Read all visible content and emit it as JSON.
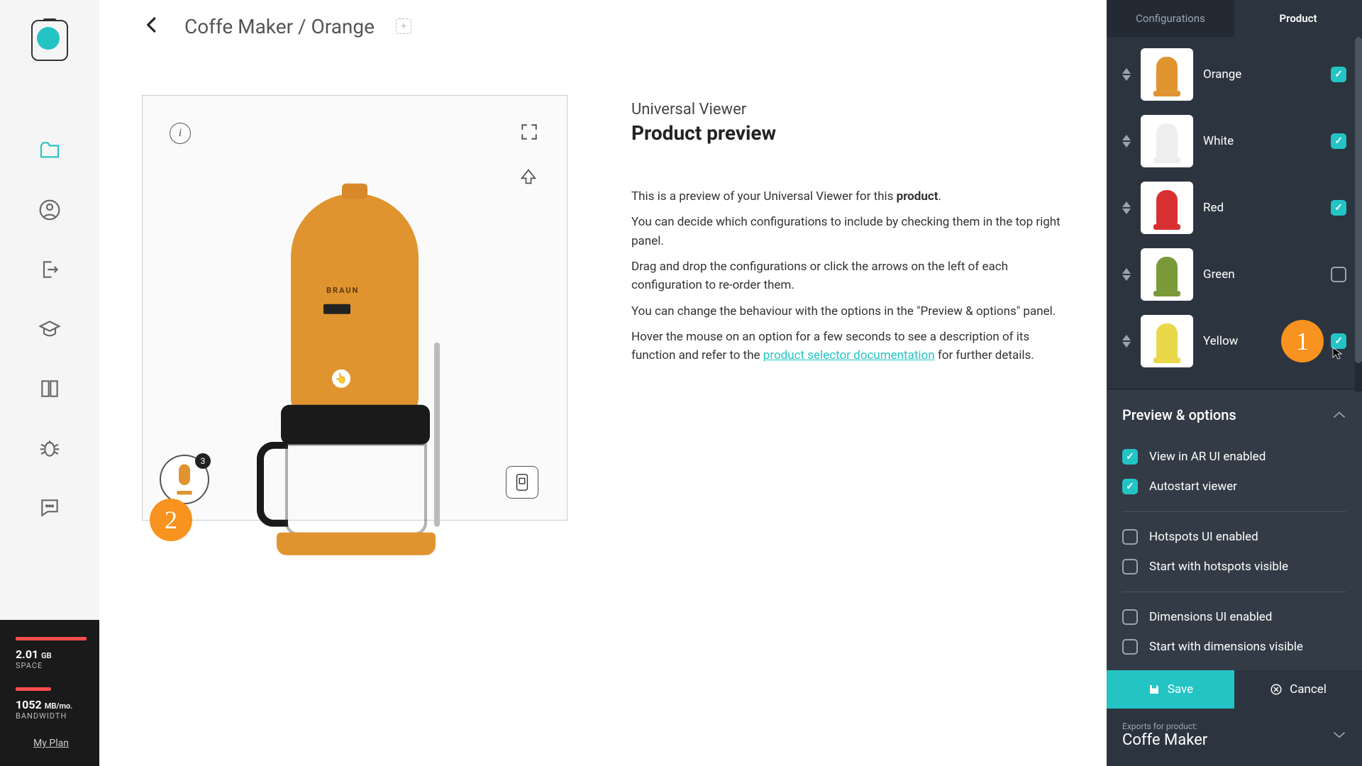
{
  "breadcrumb": "Coffe Maker / Orange",
  "sidebar_usage": {
    "space_value": "2.01",
    "space_unit": "GB",
    "space_label": "SPACE",
    "bandwidth_value": "1052",
    "bandwidth_unit": "MB/mo.",
    "bandwidth_label": "BANDWIDTH",
    "plan_link": "My Plan"
  },
  "viewer": {
    "info_icon": "i",
    "touch_icon": "👆",
    "brand_text": "BRAUN",
    "hotspot_badge": "3"
  },
  "info": {
    "subtitle": "Universal Viewer",
    "title": "Product preview",
    "p1_a": "This is a preview of your Universal Viewer for this ",
    "p1_b": "product",
    "p1_c": ".",
    "p2": "You can decide which configurations to include by checking them in the top right panel.",
    "p3": "Drag and drop the configurations or click the arrows on the left of each configuration to re-order them.",
    "p4": "You can change the behaviour with the options in the \"Preview & options\" panel.",
    "p5_a": "Hover the mouse on an option for a few seconds to see a description of its function and refer to the ",
    "p5_link": "product selector documentation",
    "p5_b": " for further details."
  },
  "panel": {
    "tabs": {
      "configurations": "Configurations",
      "product": "Product"
    },
    "configs": [
      {
        "name": "Orange",
        "color": "#e0942f",
        "checked": true
      },
      {
        "name": "White",
        "color": "#eeeeee",
        "checked": true
      },
      {
        "name": "Red",
        "color": "#d83030",
        "checked": true
      },
      {
        "name": "Green",
        "color": "#7a9a3a",
        "checked": false
      },
      {
        "name": "Yellow",
        "color": "#e8d84a",
        "checked": true
      }
    ],
    "options_title": "Preview & options",
    "options": [
      {
        "label": "View in AR UI enabled",
        "checked": true
      },
      {
        "label": "Autostart viewer",
        "checked": true
      },
      {
        "label": "Hotspots UI enabled",
        "checked": false
      },
      {
        "label": "Start with hotspots visible",
        "checked": false
      },
      {
        "label": "Dimensions UI enabled",
        "checked": false
      },
      {
        "label": "Start with dimensions visible",
        "checked": false
      }
    ],
    "save": "Save",
    "cancel": "Cancel",
    "exports_label": "Exports for product:",
    "exports_name": "Coffe Maker"
  },
  "markers": {
    "m1": "1",
    "m2": "2"
  }
}
